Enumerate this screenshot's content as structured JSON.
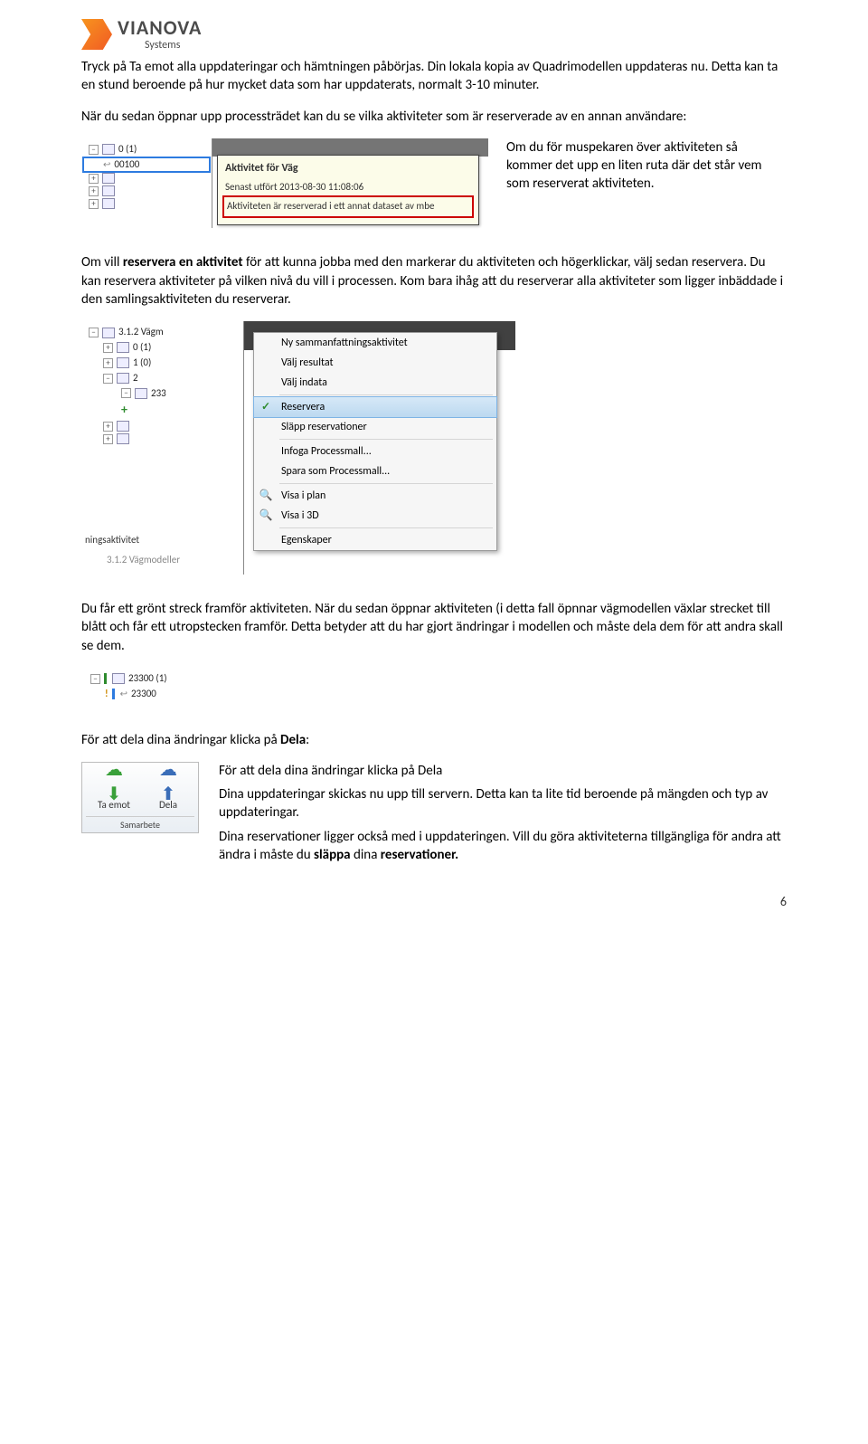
{
  "header": {
    "brand_top": "VIANOVA",
    "brand_sub": "Systems"
  },
  "para1": "Tryck på Ta emot alla uppdateringar och hämtningen påbörjas. Din lokala kopia av Quadrimodellen uppdateras nu. Detta kan ta en stund beroende på hur mycket data som har uppdaterats, normalt 3-10 minuter.",
  "para2": "När du sedan öppnar upp processträdet kan du se vilka aktiviteter som är reserverade av en annan användare:",
  "right1": "Om du för muspekaren över aktiviteten så kommer det upp en liten ruta där det står vem som reserverat aktiviteten.",
  "fig1": {
    "tree_rows": [
      {
        "btn": "−",
        "label": "0 (1)"
      },
      {
        "btn": "",
        "label": "00100",
        "boxed": true
      },
      {
        "btn": "+",
        "label": ""
      },
      {
        "btn": "+",
        "label": ""
      },
      {
        "btn": "+",
        "label": ""
      }
    ],
    "tooltip": {
      "title": "Aktivitet för Väg",
      "line2": "Senast utfört 2013-08-30 11:08:06",
      "line3": "Aktiviteten är reserverad i ett annat dataset av mbe"
    }
  },
  "para3_a": "Om vill ",
  "para3_bold": "reservera en aktivitet",
  "para3_b": " för att kunna jobba med den markerar du aktiviteten och högerklickar, välj sedan reservera. Du kan reservera aktiviteter på vilken nivå du vill i processen. Kom bara ihåg att du reserverar alla aktiviteter som ligger inbäddade i den samlingsaktiviteten du reserverar.",
  "fig2": {
    "tree_rows": [
      {
        "btn": "−",
        "label": "3.1.2 Vägm"
      },
      {
        "btn": "+",
        "label": "0 (1)",
        "indent": 1
      },
      {
        "btn": "+",
        "label": "1 (0)",
        "indent": 1
      },
      {
        "btn": "−",
        "label": "2",
        "indent": 1
      },
      {
        "btn": "−",
        "label": "233",
        "indent": 2
      },
      {
        "btn": "",
        "label": "",
        "indent": 2,
        "plus_green": true
      },
      {
        "btn": "+",
        "label": "",
        "indent": 1
      },
      {
        "btn": "+",
        "label": "",
        "indent": 1
      }
    ],
    "bottom_label": "ningsaktivitet",
    "bottom_gray": "3.1.2 Vägmodeller",
    "menu": [
      {
        "icon": "",
        "label": "Ny sammanfattningsaktivitet"
      },
      {
        "icon": "",
        "label": "Välj resultat"
      },
      {
        "icon": "",
        "label": "Välj indata"
      },
      {
        "sep": true
      },
      {
        "icon": "check",
        "label": "Reservera",
        "selected": true
      },
      {
        "icon": "",
        "label": "Släpp reservationer"
      },
      {
        "sep": true
      },
      {
        "icon": "",
        "label": "Infoga Processmall..."
      },
      {
        "icon": "",
        "label": "Spara som Processmall..."
      },
      {
        "sep": true
      },
      {
        "icon": "mag",
        "label": "Visa i plan"
      },
      {
        "icon": "mag",
        "label": "Visa i 3D"
      },
      {
        "sep": true
      },
      {
        "icon": "",
        "label": "Egenskaper"
      }
    ]
  },
  "para4": "Du får ett grönt streck framför aktiviteten. När du sedan öppnar aktiviteten (i detta fall öpnnar vägmodellen växlar strecket till blått och får ett utropstecken framför. Detta betyder att du har gjort ändringar i modellen och måste dela dem för att andra skall se dem.",
  "fig3": {
    "row1": {
      "btn": "−",
      "bar": "green",
      "label": "23300 (1)"
    },
    "row2": {
      "btn": "",
      "bar": "blue",
      "label": "23300",
      "excl": "!"
    }
  },
  "para5_a": "För att dela dina ändringar klicka på ",
  "para5_bold": "Dela",
  "para5_b": ":",
  "fig4": {
    "btn1": "Ta emot",
    "btn2": "Dela",
    "group": "Samarbete"
  },
  "right4_l1": "För att dela dina ändringar klicka på Dela",
  "right4_l2": "Dina uppdateringar skickas nu upp till servern. Detta kan ta lite tid beroende på mängden och typ av uppdateringar.",
  "right4_l3a": "Dina reservationer ligger också med i uppdateringen. Vill du göra aktiviteterna tillgängliga för andra att ändra i måste du ",
  "right4_l3bold": "släppa",
  "right4_l3b": " dina ",
  "right4_l3bold2": "reservationer.",
  "page_number": "6"
}
